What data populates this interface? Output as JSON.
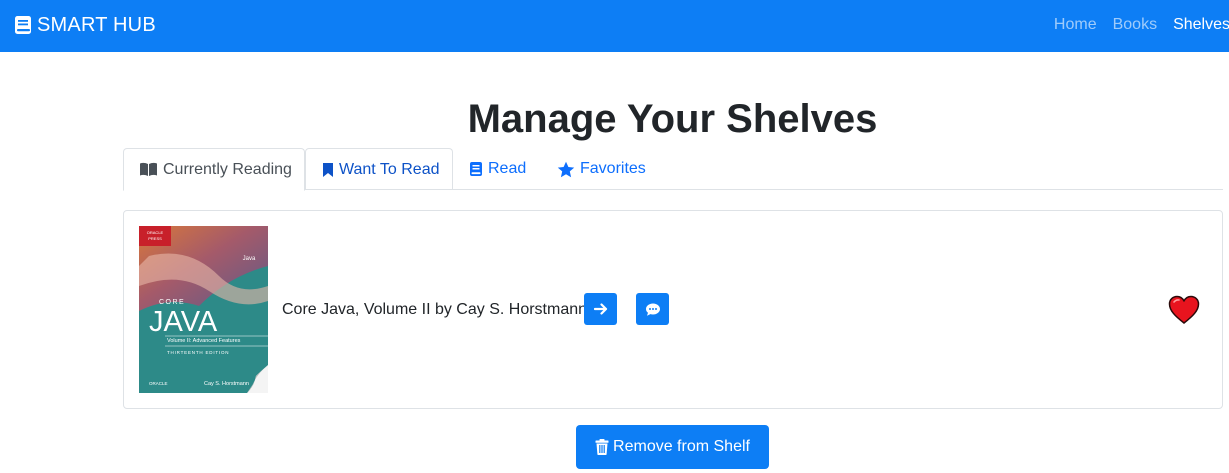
{
  "navbar": {
    "brand": "SMART HUB",
    "brand_icon": "book-icon",
    "links": [
      {
        "label": "Home",
        "active": false
      },
      {
        "label": "Books",
        "active": false
      },
      {
        "label": "Shelves",
        "active": true
      }
    ]
  },
  "page": {
    "title": "Manage Your Shelves"
  },
  "tabs": [
    {
      "label": "Currently Reading",
      "icon": "book-open-icon",
      "active": true
    },
    {
      "label": "Want To Read",
      "icon": "bookmark-icon",
      "active": false
    },
    {
      "label": "Read",
      "icon": "book-icon",
      "active": false
    },
    {
      "label": "Favorites",
      "icon": "star-icon",
      "active": false
    }
  ],
  "book": {
    "text": "Core Java, Volume II by Cay S. Horstmann",
    "favorite": true,
    "cover": {
      "badge_line1": "ORACLE",
      "badge_line2": "PRESS",
      "java_logo": "Java",
      "series": "CORE",
      "title": "JAVA",
      "subtitle": "Volume II: Advanced Features",
      "edition": "THIRTEENTH EDITION",
      "publisher": "ORACLE",
      "author": "Cay S. Horstmann"
    }
  },
  "actions": {
    "remove_label": "Remove from Shelf"
  },
  "colors": {
    "primary": "#0d7ef5",
    "heart": "#e8141e"
  }
}
